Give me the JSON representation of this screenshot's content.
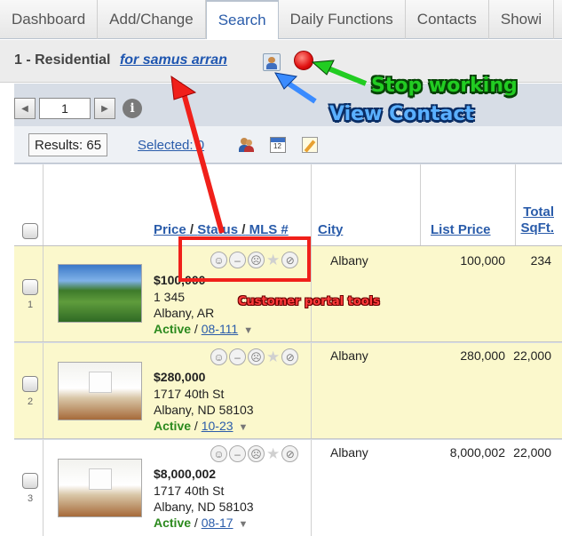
{
  "tabs": [
    "Dashboard",
    "Add/Change",
    "Search",
    "Daily Functions",
    "Contacts",
    "Showi"
  ],
  "active_tab": "Search",
  "header": {
    "title": "1 - Residential",
    "contact_link": "for samus arran"
  },
  "pager": {
    "page": "1",
    "prev_icon": "left-triangle-icon",
    "next_icon": "right-triangle-icon",
    "info_icon": "i"
  },
  "results": {
    "count_label": "Results: 65",
    "selected_label": "Selected: 0"
  },
  "columns": {
    "price": "Price",
    "status": "Status",
    "mls": "MLS #",
    "slash": "/",
    "city": "City",
    "list_price": "List Price",
    "total_sqft_1": "Total",
    "total_sqft_2": "SqFt."
  },
  "rows": [
    {
      "num": "1",
      "price": "$100,000",
      "addr1": "1 345",
      "addr2": "Albany, AR",
      "status": "Active",
      "mls": "08-111",
      "city": "Albany",
      "list_price": "100,000",
      "sqft": "234"
    },
    {
      "num": "2",
      "price": "$280,000",
      "addr1": "1717 40th St",
      "addr2": "Albany, ND 58103",
      "status": "Active",
      "mls": "10-23",
      "city": "Albany",
      "list_price": "280,000",
      "sqft": "22,000"
    },
    {
      "num": "3",
      "price": "$8,000,002",
      "addr1": "1717 40th St",
      "addr2": "Albany, ND 58103",
      "status": "Active",
      "mls": "08-17",
      "city": "Albany",
      "list_price": "8,000,002",
      "sqft": "22,000"
    }
  ],
  "annotations": {
    "stop": "Stop working",
    "view": "View Contact",
    "portal": "Customer portal tools"
  },
  "colors": {
    "annotation_red": "#f0201a",
    "annotation_green": "#22cc22",
    "annotation_blue": "#5ab0ff",
    "row_highlight": "#fbf8cc",
    "link": "#2a5caa"
  }
}
